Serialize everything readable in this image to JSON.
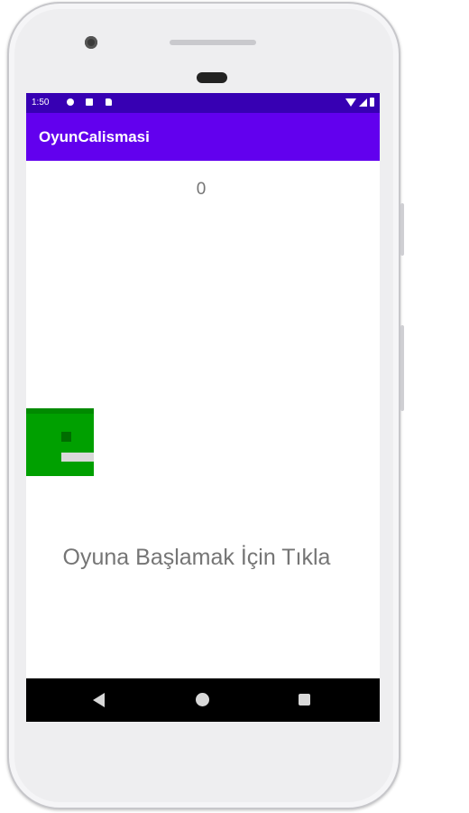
{
  "status_bar": {
    "time": "1:50",
    "left_icons": [
      "settings-icon",
      "square-notification-icon",
      "sd-card-icon"
    ],
    "right_icons": [
      "wifi-icon",
      "cell-signal-icon",
      "battery-icon"
    ],
    "background": "#3700b3"
  },
  "app_bar": {
    "title": "OyunCalismasi",
    "background": "#6200ee"
  },
  "game": {
    "score": "0",
    "start_prompt": "Oyuna Başlamak İçin Tıkla",
    "player_color": "#00a000"
  },
  "nav_bar": {
    "icons": [
      "back-icon",
      "home-icon",
      "recents-icon"
    ]
  }
}
